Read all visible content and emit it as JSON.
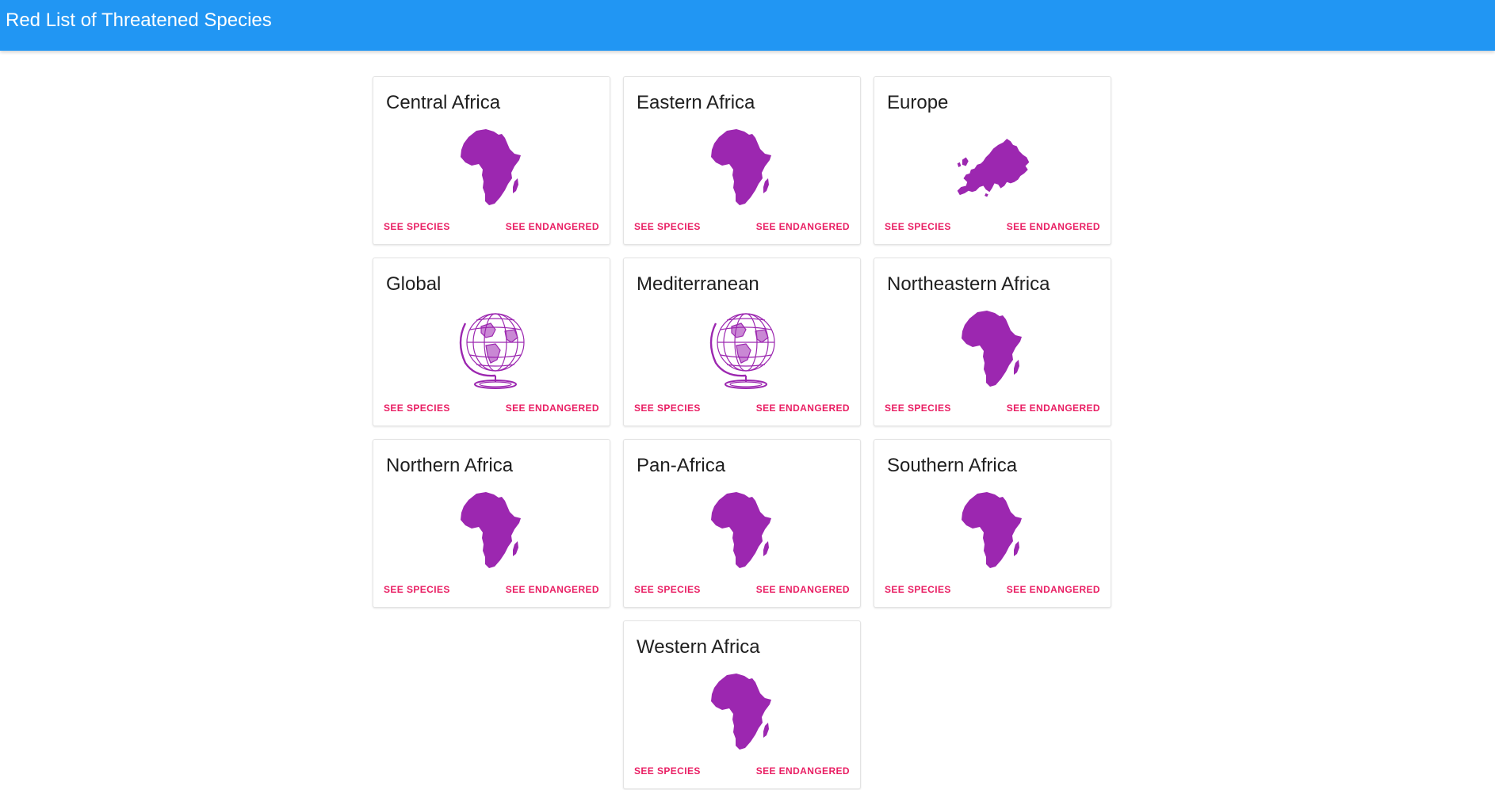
{
  "app": {
    "title": "Red List of Threatened Species"
  },
  "colors": {
    "appbar": "#2196f3",
    "accent": "#e91e63",
    "map": "#9c27b0"
  },
  "regions": [
    {
      "name": "Central Africa",
      "icon": "africa-map-icon",
      "see_species": "SEE SPECIES",
      "see_endangered": "SEE ENDANGERED"
    },
    {
      "name": "Eastern Africa",
      "icon": "africa-map-icon",
      "see_species": "SEE SPECIES",
      "see_endangered": "SEE ENDANGERED"
    },
    {
      "name": "Europe",
      "icon": "europe-map-icon",
      "see_species": "SEE SPECIES",
      "see_endangered": "SEE ENDANGERED"
    },
    {
      "name": "Global",
      "icon": "globe-icon",
      "see_species": "SEE SPECIES",
      "see_endangered": "SEE ENDANGERED"
    },
    {
      "name": "Mediterranean",
      "icon": "globe-icon",
      "see_species": "SEE SPECIES",
      "see_endangered": "SEE ENDANGERED"
    },
    {
      "name": "Northeastern Africa",
      "icon": "africa-map-icon",
      "see_species": "SEE SPECIES",
      "see_endangered": "SEE ENDANGERED"
    },
    {
      "name": "Northern Africa",
      "icon": "africa-map-icon",
      "see_species": "SEE SPECIES",
      "see_endangered": "SEE ENDANGERED"
    },
    {
      "name": "Pan-Africa",
      "icon": "africa-map-icon",
      "see_species": "SEE SPECIES",
      "see_endangered": "SEE ENDANGERED"
    },
    {
      "name": "Southern Africa",
      "icon": "africa-map-icon",
      "see_species": "SEE SPECIES",
      "see_endangered": "SEE ENDANGERED"
    },
    {
      "name": "Western Africa",
      "icon": "africa-map-icon",
      "see_species": "SEE SPECIES",
      "see_endangered": "SEE ENDANGERED"
    }
  ]
}
